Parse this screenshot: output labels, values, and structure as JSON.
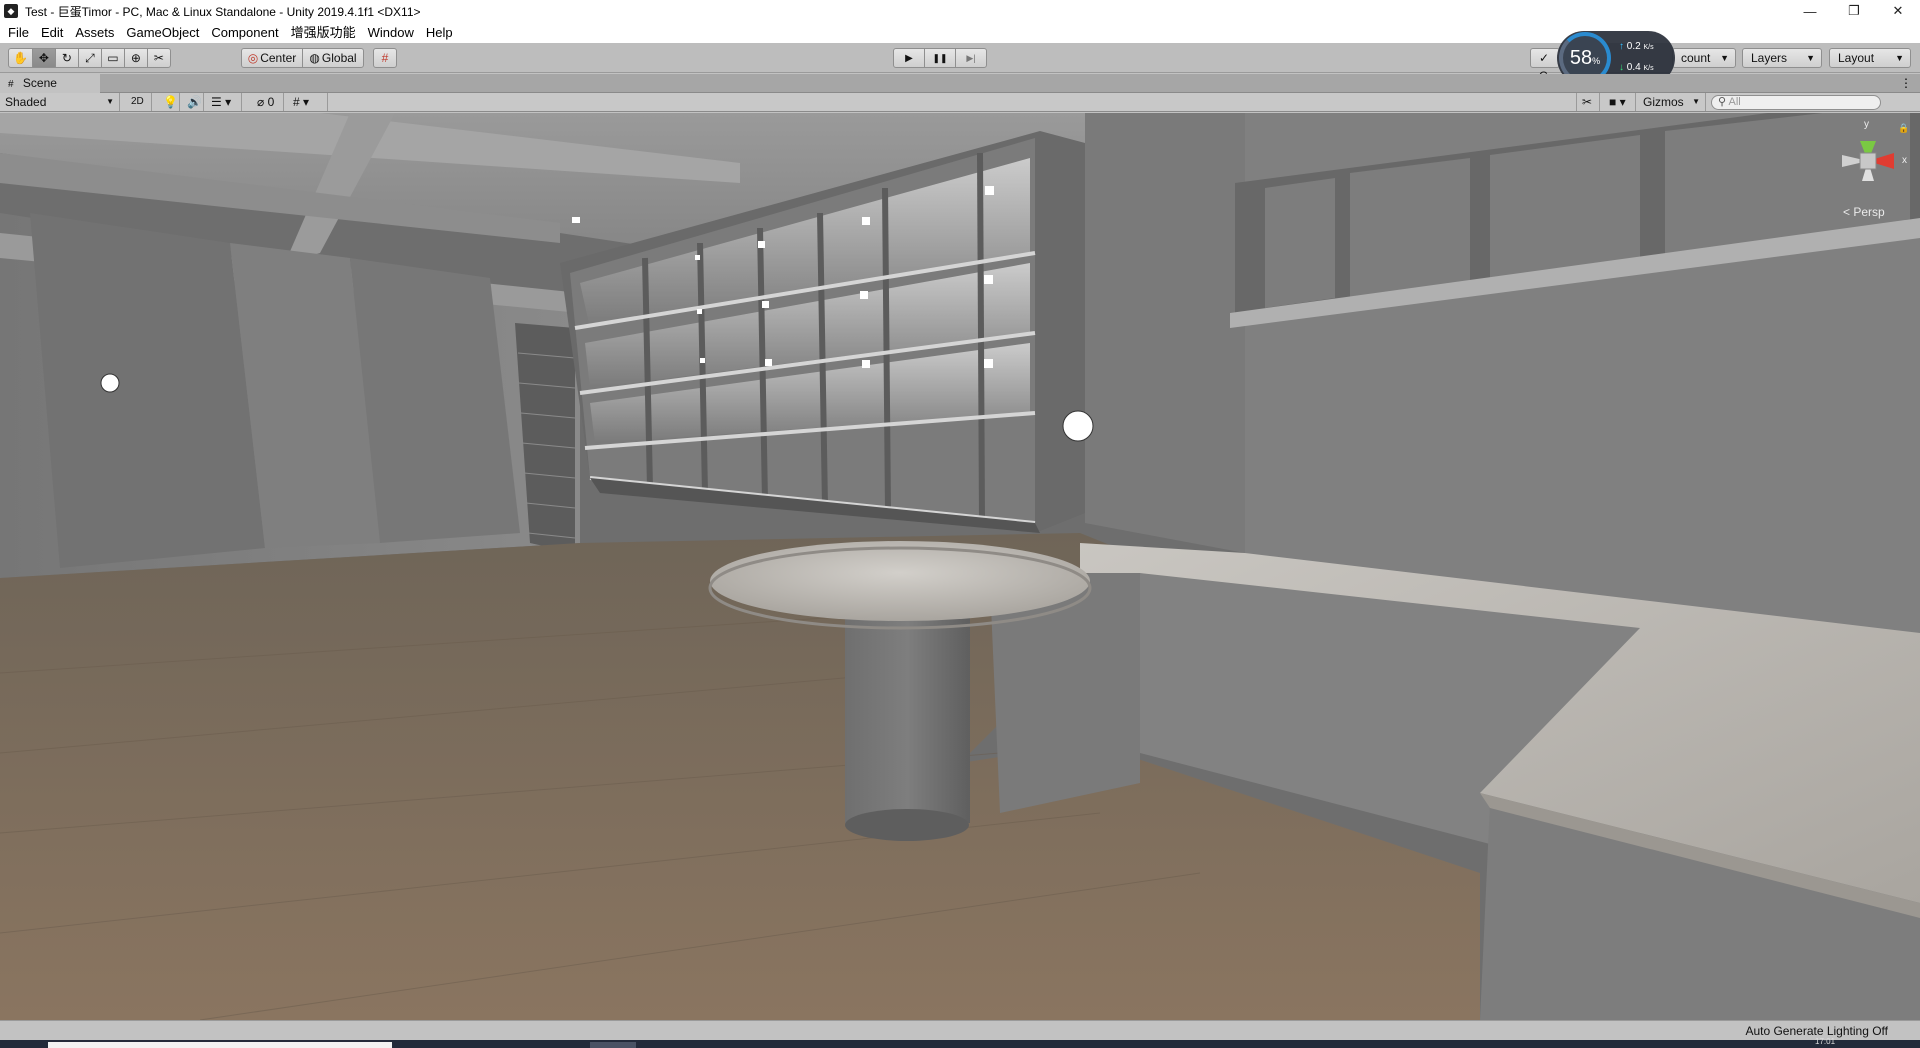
{
  "window": {
    "title": "Test - 巨蛋Timor - PC, Mac & Linux Standalone - Unity 2019.4.1f1 <DX11>",
    "app_icon": "unity-logo-icon",
    "controls": {
      "minimize": "—",
      "restore": "❐",
      "close": "✕"
    }
  },
  "menubar": {
    "items": [
      "File",
      "Edit",
      "Assets",
      "GameObject",
      "Component",
      "增强版功能",
      "Window",
      "Help"
    ]
  },
  "toolbar": {
    "transform_tools": [
      "hand-tool-icon",
      "move-tool-icon",
      "rotate-tool-icon",
      "scale-tool-icon",
      "rect-tool-icon",
      "transform-tool-icon",
      "custom-tool-icon"
    ],
    "pivot_mode": "Center",
    "pivot_rotation": "Global",
    "snap_icon": "grid-snap-icon",
    "play_icon": "▶",
    "pause_icon": "❚❚",
    "step_icon": "▶|",
    "collab_label": "C",
    "account_label": "count",
    "layers_label": "Layers",
    "layout_label": "Layout"
  },
  "perf_overlay": {
    "percent": "58",
    "percent_unit": "%",
    "upload": "0.2",
    "download": "0.4",
    "rate_unit": "K/s"
  },
  "scene_tab": {
    "label": "Scene",
    "more": "⋮"
  },
  "scene_toolbar": {
    "shading_mode": "Shaded",
    "mode_2d": "2D",
    "hidden_count": "0",
    "gizmos_label": "Gizmos",
    "search_placeholder": "All"
  },
  "viewport": {
    "projection_label": "< Persp",
    "axis_y": "y",
    "axis_x": "x"
  },
  "status": {
    "lighting": "Auto Generate Lighting Off",
    "clock": "17:01"
  },
  "colors": {
    "editor_bg": "#c2c2c2",
    "floor_wood": "#7f6a55",
    "wall": "#7a7a7a",
    "countertop": "#bdbab5",
    "perf_accent": "#2a8bd0"
  }
}
